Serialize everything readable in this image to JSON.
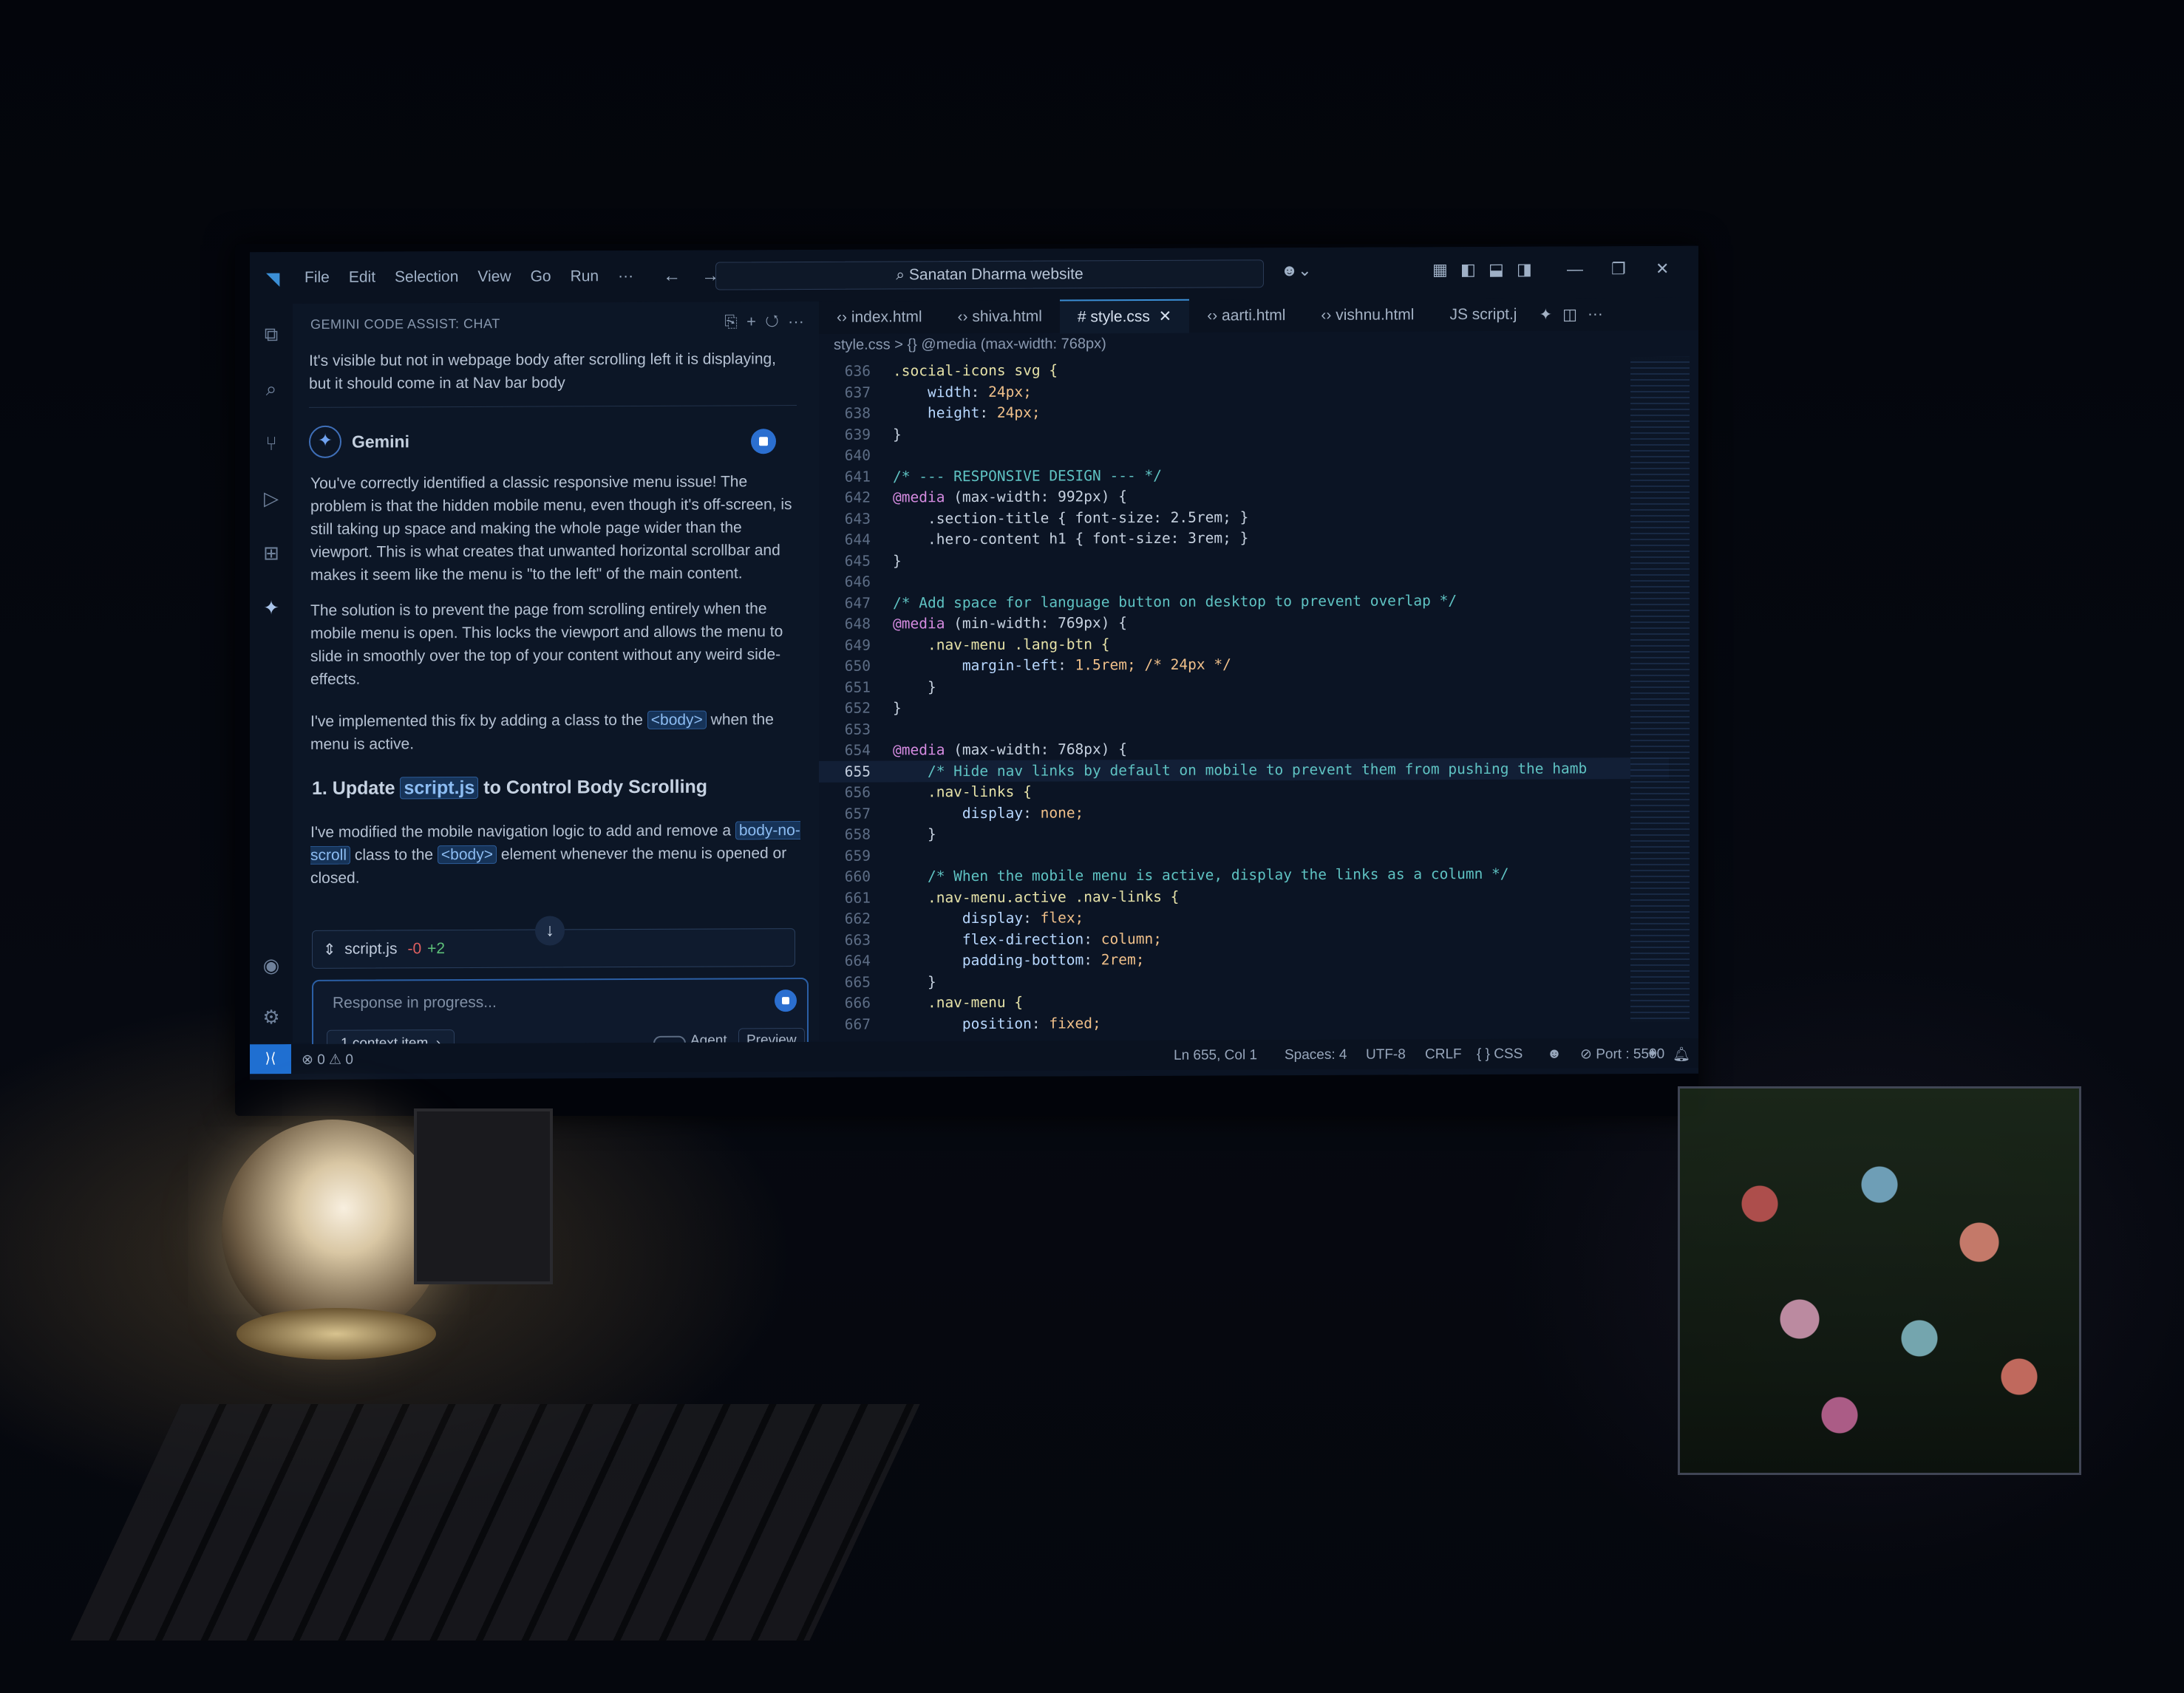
{
  "titlebar": {
    "menu": [
      "File",
      "Edit",
      "Selection",
      "View",
      "Go",
      "Run",
      "···"
    ],
    "search": "Sanatan Dharma website"
  },
  "chat": {
    "header": "GEMINI CODE ASSIST: CHAT",
    "user_message": "It's visible but not in webpage body after scrolling left it is displaying, but it should come in at Nav bar body",
    "assistant_name": "Gemini",
    "p1": "You've correctly identified a classic responsive menu issue! The problem is that the hidden mobile menu, even though it's off-screen, is still taking up space and making the whole page wider than the viewport. This is what creates that unwanted horizontal scrollbar and makes it seem like the menu is \"to the left\" of the main content.",
    "p2": "The solution is to prevent the page from scrolling entirely when the mobile menu is open. This locks the viewport and allows the menu to slide in smoothly over the top of your content without any weird side-effects.",
    "p3_pre": "I've implemented this fix by adding a class to the ",
    "p3_chip": "<body>",
    "p3_post": " when the menu is active.",
    "h1_pre": "1. Update ",
    "h1_chip": "script.js",
    "h1_post": " to Control Body Scrolling",
    "p4_pre": "I've modified the mobile navigation logic to add and remove a ",
    "p4_chip1": "body-no-scroll",
    "p4_mid": " class to the ",
    "p4_chip2": "<body>",
    "p4_post": " element whenever the menu is opened or closed.",
    "diff_file": "script.js",
    "diff_del": "-0",
    "diff_add": "+2",
    "input_placeholder": "Response in progress...",
    "context_button": "1 context item",
    "agent_label": "Agent",
    "preview_label": "Preview"
  },
  "tabs": [
    "index.html",
    "shiva.html",
    "style.css",
    "aarti.html",
    "vishnu.html",
    "script.j"
  ],
  "active_tab": "style.css",
  "breadcrumb": "style.css > {} @media (max-width: 768px)",
  "code": {
    "lines": [
      {
        "n": "636",
        "t": ".social-icons svg {"
      },
      {
        "n": "637",
        "t": "    width: 24px;"
      },
      {
        "n": "638",
        "t": "    height: 24px;"
      },
      {
        "n": "639",
        "t": "}"
      },
      {
        "n": "640",
        "t": ""
      },
      {
        "n": "641",
        "t": "/* --- RESPONSIVE DESIGN --- */"
      },
      {
        "n": "642",
        "t": "@media (max-width: 992px) {"
      },
      {
        "n": "643",
        "t": "    .section-title { font-size: 2.5rem; }"
      },
      {
        "n": "644",
        "t": "    .hero-content h1 { font-size: 3rem; }"
      },
      {
        "n": "645",
        "t": "}"
      },
      {
        "n": "646",
        "t": ""
      },
      {
        "n": "647",
        "t": "/* Add space for language button on desktop to prevent overlap */"
      },
      {
        "n": "648",
        "t": "@media (min-width: 769px) {"
      },
      {
        "n": "649",
        "t": "    .nav-menu .lang-btn {"
      },
      {
        "n": "650",
        "t": "        margin-left: 1.5rem; /* 24px */"
      },
      {
        "n": "651",
        "t": "    }"
      },
      {
        "n": "652",
        "t": "}"
      },
      {
        "n": "653",
        "t": ""
      },
      {
        "n": "654",
        "t": "@media (max-width: 768px) {"
      },
      {
        "n": "655",
        "t": "    /* Hide nav links by default on mobile to prevent them from pushing the hamb"
      },
      {
        "n": "656",
        "t": "    .nav-links {"
      },
      {
        "n": "657",
        "t": "        display: none;"
      },
      {
        "n": "658",
        "t": "    }"
      },
      {
        "n": "659",
        "t": ""
      },
      {
        "n": "660",
        "t": "    /* When the mobile menu is active, display the links as a column */"
      },
      {
        "n": "661",
        "t": "    .nav-menu.active .nav-links {"
      },
      {
        "n": "662",
        "t": "        display: flex;"
      },
      {
        "n": "663",
        "t": "        flex-direction: column;"
      },
      {
        "n": "664",
        "t": "        padding-bottom: 2rem;"
      },
      {
        "n": "665",
        "t": "    }"
      },
      {
        "n": "666",
        "t": "    .nav-menu {"
      },
      {
        "n": "667",
        "t": "        position: fixed;"
      }
    ],
    "current_line": "655"
  },
  "statusbar": {
    "problems": "⊗ 0 ⚠ 0",
    "position": "Ln 655, Col 1",
    "spaces": "Spaces: 4",
    "encoding": "UTF-8",
    "eol": "CRLF",
    "language": "{ } CSS",
    "port": "⊘ Port : 5500"
  },
  "colors": {
    "accent": "#3b8fd6",
    "stop": "#2b6fd0"
  }
}
